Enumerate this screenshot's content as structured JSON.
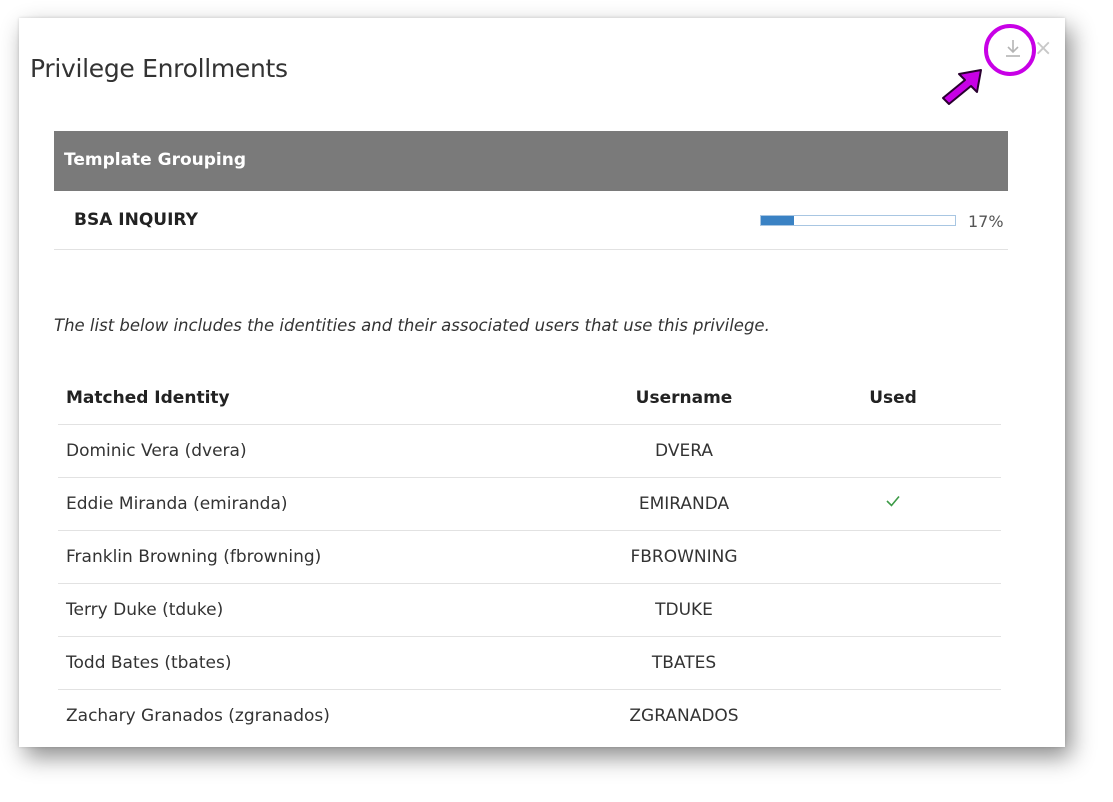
{
  "modal": {
    "title": "Privilege Enrollments",
    "download_icon": "download-icon",
    "close_icon": "close-icon",
    "close_glyph": "×"
  },
  "group": {
    "header_label": "Template Grouping",
    "name": "BSA INQUIRY",
    "progress_percent": 17,
    "progress_label": "17%"
  },
  "description": "The list below includes the identities and their associated users that use this privilege.",
  "table": {
    "columns": [
      "Matched Identity",
      "Username",
      "Used"
    ],
    "rows": [
      {
        "identity": "Dominic Vera (dvera)",
        "username": "DVERA",
        "used": false
      },
      {
        "identity": "Eddie Miranda (emiranda)",
        "username": "EMIRANDA",
        "used": true
      },
      {
        "identity": "Franklin Browning (fbrowning)",
        "username": "FBROWNING",
        "used": false
      },
      {
        "identity": "Terry Duke (tduke)",
        "username": "TDUKE",
        "used": false
      },
      {
        "identity": "Todd Bates (tbates)",
        "username": "TBATES",
        "used": false
      },
      {
        "identity": "Zachary Granados (zgranados)",
        "username": "ZGRANADOS",
        "used": false
      }
    ]
  },
  "colors": {
    "header_bg": "#7a7a7a",
    "progress_fill": "#3a82c4",
    "check": "#3c9a46",
    "annotation": "#c800e6"
  }
}
